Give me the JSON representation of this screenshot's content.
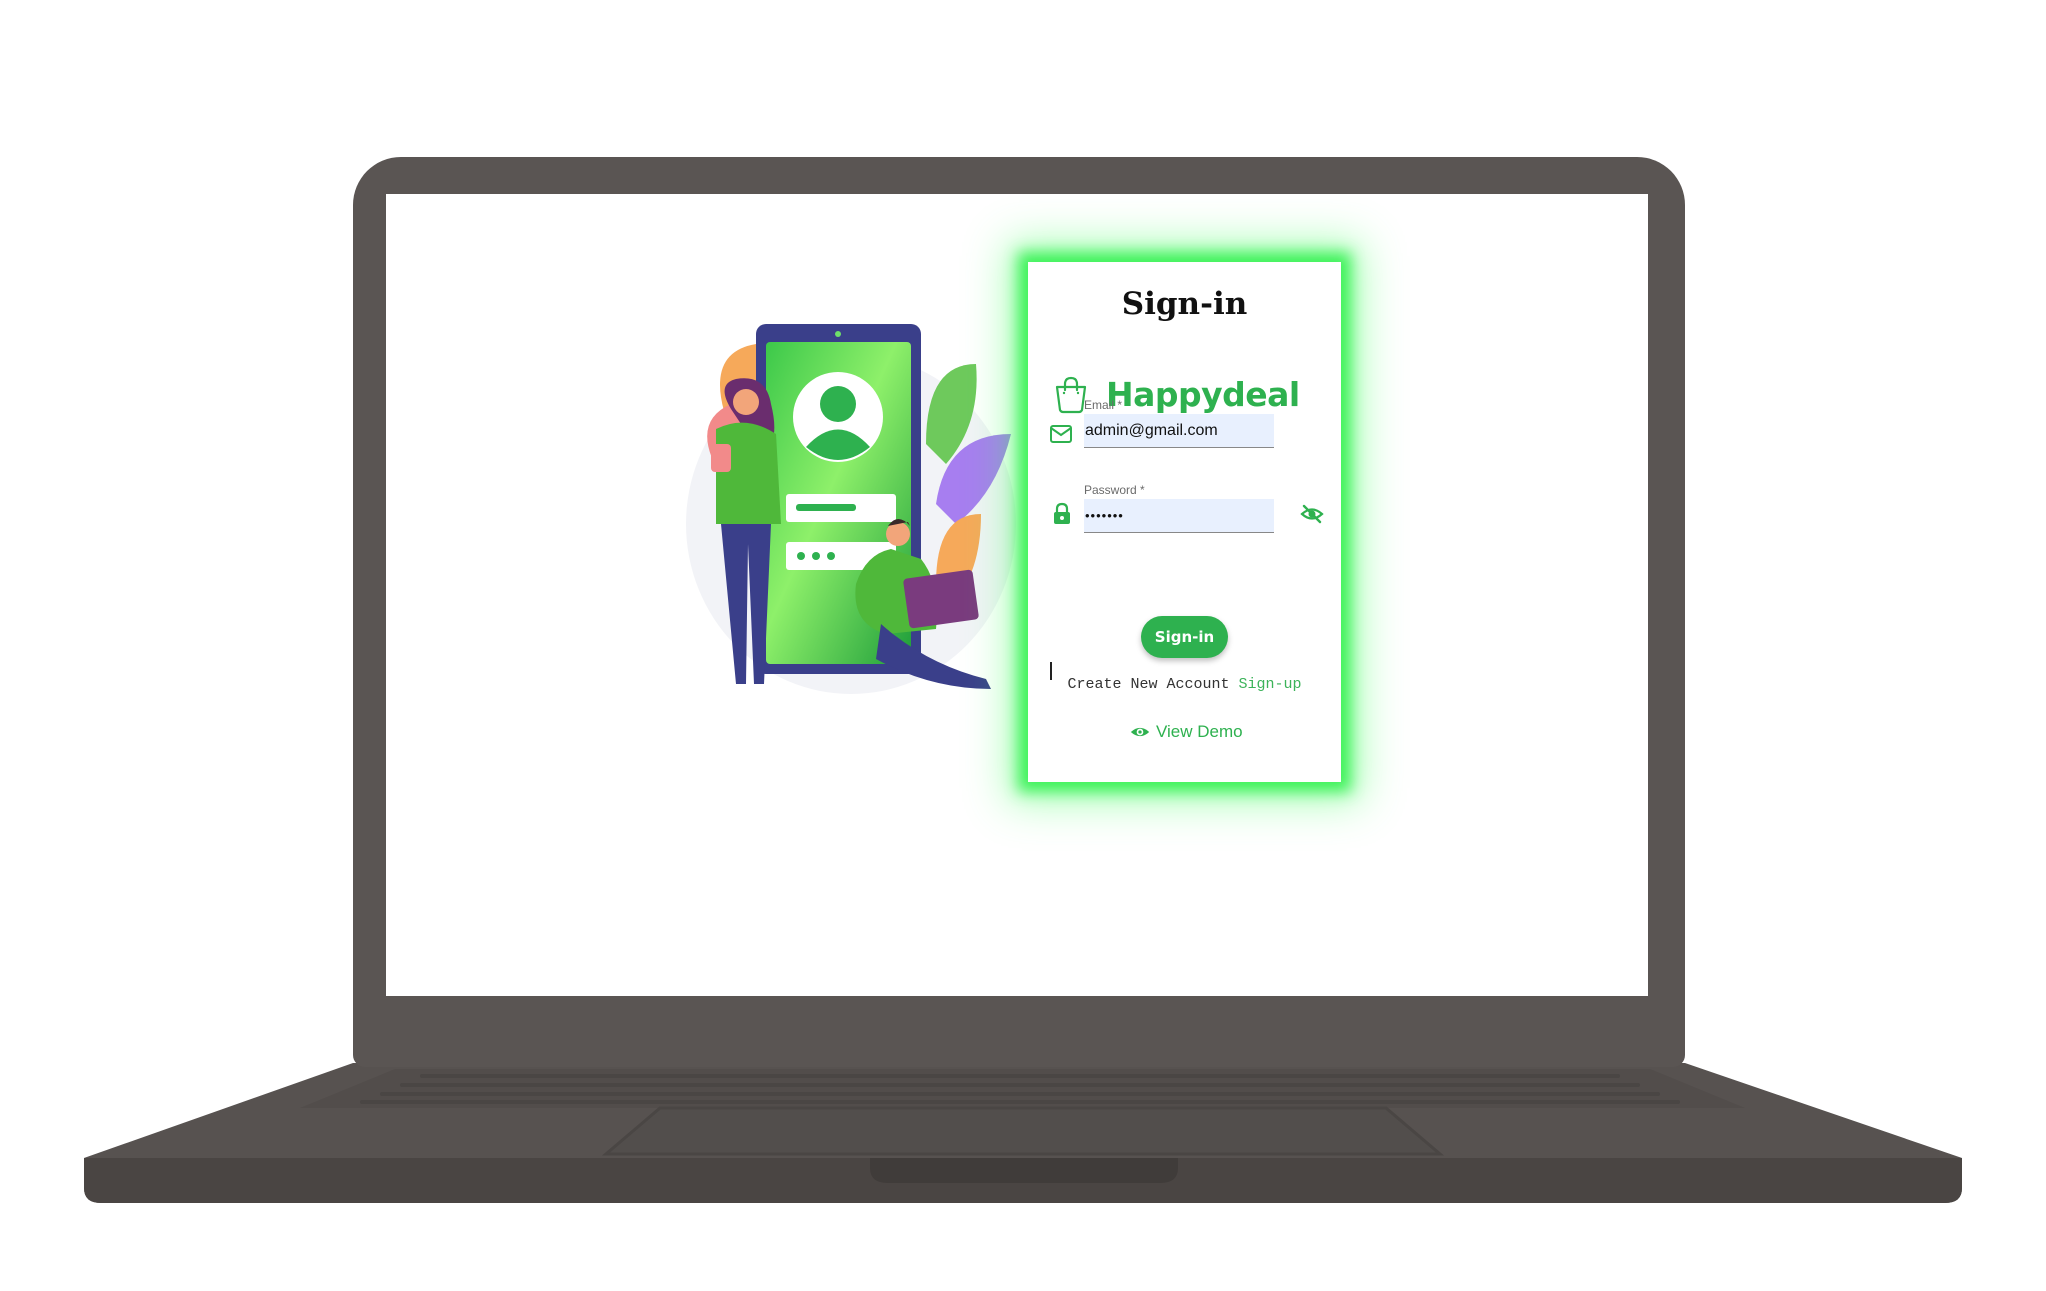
{
  "signin": {
    "title": "Sign-in",
    "brand_name": "Happydeal",
    "email": {
      "label": "Email *",
      "value": "admin@gmail.com"
    },
    "password": {
      "label": "Password *",
      "value": "•••••••"
    },
    "submit_label": "Sign-in",
    "create_text": "Create New Account",
    "signup_link": "Sign-up",
    "view_demo_label": "View Demo"
  },
  "colors": {
    "brand_green": "#2eb14f",
    "glow_green": "#28f046",
    "laptop_body": "#5a5553",
    "input_bg": "#e8f0fe"
  },
  "icons": [
    "shopping-bag-icon",
    "mail-icon",
    "lock-icon",
    "eye-off-icon",
    "eye-icon"
  ]
}
